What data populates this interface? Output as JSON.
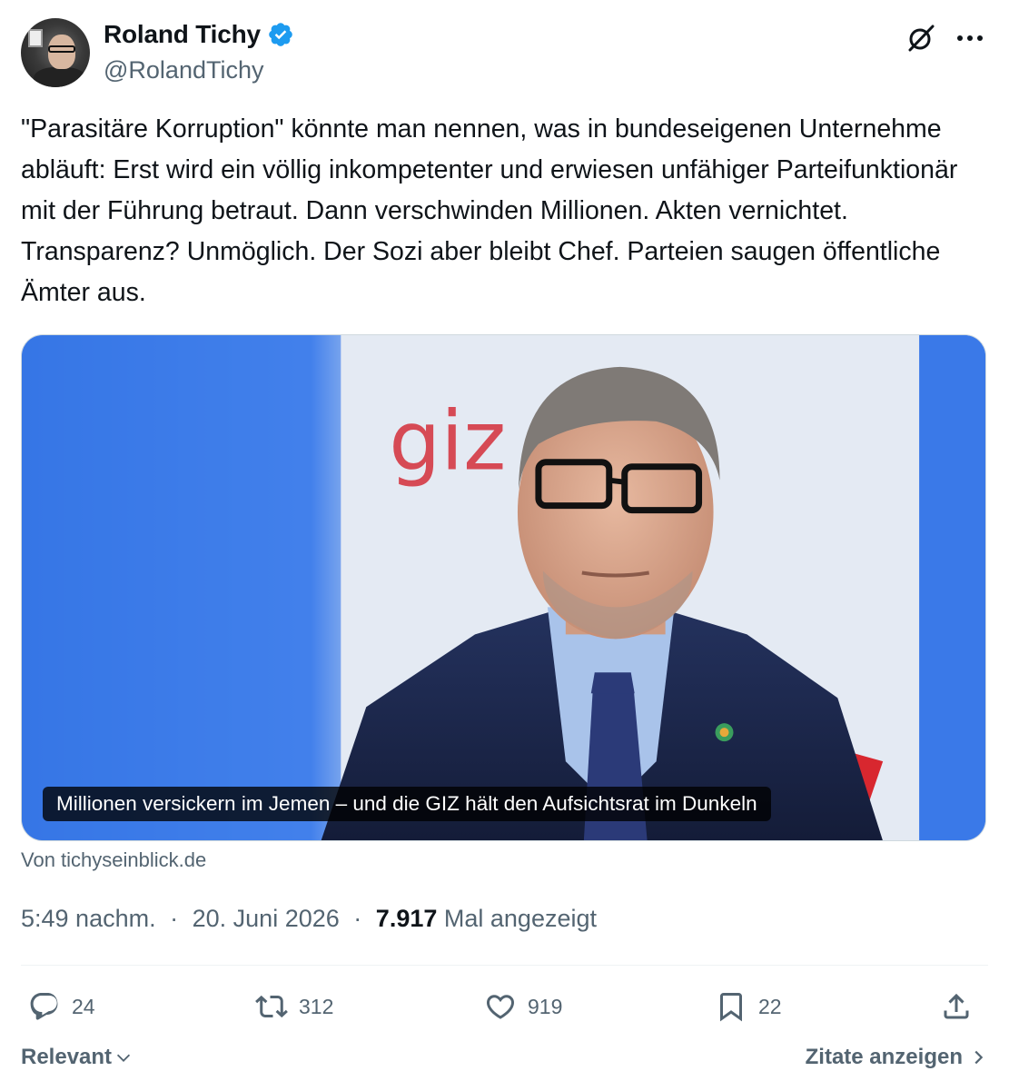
{
  "author": {
    "display_name": "Roland Tichy",
    "handle": "@RolandTichy"
  },
  "tweet": {
    "text": "\"Parasitäre Korruption\" könnte man nennen, was in bundeseigenen Unternehme abläuft: Erst wird ein völlig inkompetenter und erwiesen unfähiger Parteifunktionär mit der Führung betraut. Dann verschwinden Millionen. Akten vernichtet. Transparenz? Unmöglich. Der Sozi aber bleibt Chef. Parteien saugen öffentliche Ämter aus."
  },
  "card": {
    "title": "Millionen versickern im Jemen – und die GIZ hält den Aufsichtsrat im Dunkeln",
    "source": "Von tichyseinblick.de",
    "photo_sign_text": "giz"
  },
  "meta": {
    "time": "5:49 nachm.",
    "date": "20. Juni 2026",
    "views_count": "7.917",
    "views_label": "Mal angezeigt",
    "separator": "·"
  },
  "actions": {
    "replies": "24",
    "reposts": "312",
    "likes": "919",
    "bookmarks": "22"
  },
  "footer": {
    "sort_label": "Relevant",
    "quotes_label": "Zitate anzeigen"
  },
  "colors": {
    "text_primary": "#0f1419",
    "text_secondary": "#536471",
    "verified_blue": "#1d9bf0",
    "divider": "#eff3f4"
  },
  "icons": {
    "verified": "verified-badge-icon",
    "grok": "grok-icon",
    "more": "more-horizontal-icon",
    "reply": "reply-icon",
    "repost": "repost-icon",
    "like": "heart-icon",
    "bookmark": "bookmark-icon",
    "share": "share-icon",
    "chevron_down": "chevron-down-icon",
    "chevron_right": "chevron-right-icon"
  }
}
